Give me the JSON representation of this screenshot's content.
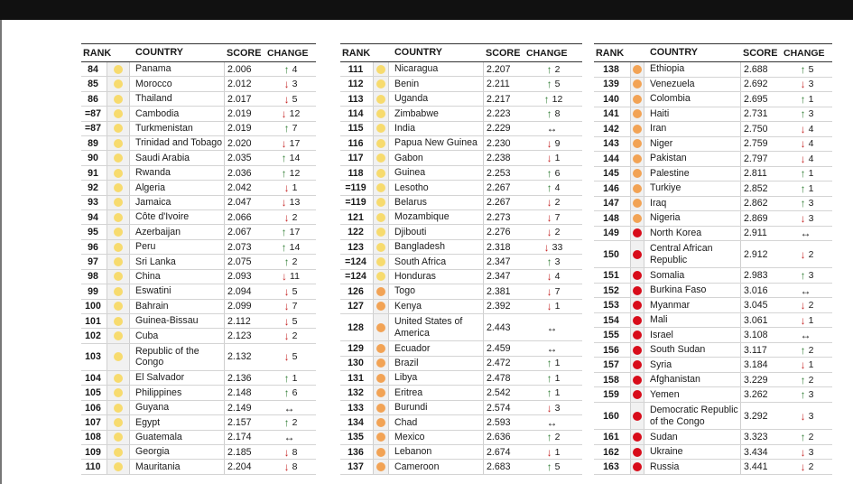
{
  "colors": {
    "very_high": "#d80c1a",
    "high": "#f2a355",
    "medium": "#f7db6e",
    "up_arrow": "#2e7d32",
    "down_arrow": "#c62828",
    "same_arrow": "#1a1a1a"
  },
  "headers": {
    "rank": "RANK",
    "country": "COUNTRY",
    "score": "SCORE",
    "change": "CHANGE"
  },
  "tables": [
    {
      "rows": [
        {
          "rank": "84",
          "country": "Panama",
          "score": "2.006",
          "dir": "up",
          "amount": "4",
          "level": "medium"
        },
        {
          "rank": "85",
          "country": "Morocco",
          "score": "2.012",
          "dir": "down",
          "amount": "3",
          "level": "medium"
        },
        {
          "rank": "86",
          "country": "Thailand",
          "score": "2.017",
          "dir": "down",
          "amount": "5",
          "level": "medium"
        },
        {
          "rank": "=87",
          "country": "Cambodia",
          "score": "2.019",
          "dir": "down",
          "amount": "12",
          "level": "medium"
        },
        {
          "rank": "=87",
          "country": "Turkmenistan",
          "score": "2.019",
          "dir": "up",
          "amount": "7",
          "level": "medium"
        },
        {
          "rank": "89",
          "country": "Trinidad and Tobago",
          "score": "2.020",
          "dir": "down",
          "amount": "17",
          "level": "medium"
        },
        {
          "rank": "90",
          "country": "Saudi Arabia",
          "score": "2.035",
          "dir": "up",
          "amount": "14",
          "level": "medium"
        },
        {
          "rank": "91",
          "country": "Rwanda",
          "score": "2.036",
          "dir": "up",
          "amount": "12",
          "level": "medium"
        },
        {
          "rank": "92",
          "country": "Algeria",
          "score": "2.042",
          "dir": "down",
          "amount": "1",
          "level": "medium"
        },
        {
          "rank": "93",
          "country": "Jamaica",
          "score": "2.047",
          "dir": "down",
          "amount": "13",
          "level": "medium"
        },
        {
          "rank": "94",
          "country": "Côte d'Ivoire",
          "score": "2.066",
          "dir": "down",
          "amount": "2",
          "level": "medium"
        },
        {
          "rank": "95",
          "country": "Azerbaijan",
          "score": "2.067",
          "dir": "up",
          "amount": "17",
          "level": "medium"
        },
        {
          "rank": "96",
          "country": "Peru",
          "score": "2.073",
          "dir": "up",
          "amount": "14",
          "level": "medium"
        },
        {
          "rank": "97",
          "country": "Sri Lanka",
          "score": "2.075",
          "dir": "up",
          "amount": "2",
          "level": "medium"
        },
        {
          "rank": "98",
          "country": "China",
          "score": "2.093",
          "dir": "down",
          "amount": "11",
          "level": "medium"
        },
        {
          "rank": "99",
          "country": "Eswatini",
          "score": "2.094",
          "dir": "down",
          "amount": "5",
          "level": "medium"
        },
        {
          "rank": "100",
          "country": "Bahrain",
          "score": "2.099",
          "dir": "down",
          "amount": "7",
          "level": "medium"
        },
        {
          "rank": "101",
          "country": "Guinea-Bissau",
          "score": "2.112",
          "dir": "down",
          "amount": "5",
          "level": "medium"
        },
        {
          "rank": "102",
          "country": "Cuba",
          "score": "2.123",
          "dir": "down",
          "amount": "2",
          "level": "medium"
        },
        {
          "rank": "103",
          "country": "Republic of the Congo",
          "score": "2.132",
          "dir": "down",
          "amount": "5",
          "level": "medium",
          "tall": true
        },
        {
          "rank": "104",
          "country": "El Salvador",
          "score": "2.136",
          "dir": "up",
          "amount": "1",
          "level": "medium"
        },
        {
          "rank": "105",
          "country": "Philippines",
          "score": "2.148",
          "dir": "up",
          "amount": "6",
          "level": "medium"
        },
        {
          "rank": "106",
          "country": "Guyana",
          "score": "2.149",
          "dir": "same",
          "amount": "",
          "level": "medium"
        },
        {
          "rank": "107",
          "country": "Egypt",
          "score": "2.157",
          "dir": "up",
          "amount": "2",
          "level": "medium"
        },
        {
          "rank": "108",
          "country": "Guatemala",
          "score": "2.174",
          "dir": "same",
          "amount": "",
          "level": "medium"
        },
        {
          "rank": "109",
          "country": "Georgia",
          "score": "2.185",
          "dir": "down",
          "amount": "8",
          "level": "medium"
        },
        {
          "rank": "110",
          "country": "Mauritania",
          "score": "2.204",
          "dir": "down",
          "amount": "8",
          "level": "medium"
        }
      ]
    },
    {
      "rows": [
        {
          "rank": "111",
          "country": "Nicaragua",
          "score": "2.207",
          "dir": "up",
          "amount": "2",
          "level": "medium"
        },
        {
          "rank": "112",
          "country": "Benin",
          "score": "2.211",
          "dir": "up",
          "amount": "5",
          "level": "medium"
        },
        {
          "rank": "113",
          "country": "Uganda",
          "score": "2.217",
          "dir": "up",
          "amount": "12",
          "level": "medium"
        },
        {
          "rank": "114",
          "country": "Zimbabwe",
          "score": "2.223",
          "dir": "up",
          "amount": "8",
          "level": "medium"
        },
        {
          "rank": "115",
          "country": "India",
          "score": "2.229",
          "dir": "same",
          "amount": "",
          "level": "medium"
        },
        {
          "rank": "116",
          "country": "Papua New Guinea",
          "score": "2.230",
          "dir": "down",
          "amount": "9",
          "level": "medium"
        },
        {
          "rank": "117",
          "country": "Gabon",
          "score": "2.238",
          "dir": "down",
          "amount": "1",
          "level": "medium"
        },
        {
          "rank": "118",
          "country": "Guinea",
          "score": "2.253",
          "dir": "up",
          "amount": "6",
          "level": "medium"
        },
        {
          "rank": "=119",
          "country": "Lesotho",
          "score": "2.267",
          "dir": "up",
          "amount": "4",
          "level": "medium"
        },
        {
          "rank": "=119",
          "country": "Belarus",
          "score": "2.267",
          "dir": "down",
          "amount": "2",
          "level": "medium"
        },
        {
          "rank": "121",
          "country": "Mozambique",
          "score": "2.273",
          "dir": "down",
          "amount": "7",
          "level": "medium"
        },
        {
          "rank": "122",
          "country": "Djibouti",
          "score": "2.276",
          "dir": "down",
          "amount": "2",
          "level": "medium"
        },
        {
          "rank": "123",
          "country": "Bangladesh",
          "score": "2.318",
          "dir": "down",
          "amount": "33",
          "level": "medium"
        },
        {
          "rank": "=124",
          "country": "South Africa",
          "score": "2.347",
          "dir": "up",
          "amount": "3",
          "level": "medium"
        },
        {
          "rank": "=124",
          "country": "Honduras",
          "score": "2.347",
          "dir": "down",
          "amount": "4",
          "level": "medium"
        },
        {
          "rank": "126",
          "country": "Togo",
          "score": "2.381",
          "dir": "down",
          "amount": "7",
          "level": "high"
        },
        {
          "rank": "127",
          "country": "Kenya",
          "score": "2.392",
          "dir": "down",
          "amount": "1",
          "level": "high"
        },
        {
          "rank": "128",
          "country": "United States of America",
          "score": "2.443",
          "dir": "same",
          "amount": "",
          "level": "high",
          "tall": true
        },
        {
          "rank": "129",
          "country": "Ecuador",
          "score": "2.459",
          "dir": "same",
          "amount": "",
          "level": "high"
        },
        {
          "rank": "130",
          "country": "Brazil",
          "score": "2.472",
          "dir": "up",
          "amount": "1",
          "level": "high"
        },
        {
          "rank": "131",
          "country": "Libya",
          "score": "2.478",
          "dir": "up",
          "amount": "1",
          "level": "high"
        },
        {
          "rank": "132",
          "country": "Eritrea",
          "score": "2.542",
          "dir": "up",
          "amount": "1",
          "level": "high"
        },
        {
          "rank": "133",
          "country": "Burundi",
          "score": "2.574",
          "dir": "down",
          "amount": "3",
          "level": "high"
        },
        {
          "rank": "134",
          "country": "Chad",
          "score": "2.593",
          "dir": "same",
          "amount": "",
          "level": "high"
        },
        {
          "rank": "135",
          "country": "Mexico",
          "score": "2.636",
          "dir": "up",
          "amount": "2",
          "level": "high"
        },
        {
          "rank": "136",
          "country": "Lebanon",
          "score": "2.674",
          "dir": "down",
          "amount": "1",
          "level": "high"
        },
        {
          "rank": "137",
          "country": "Cameroon",
          "score": "2.683",
          "dir": "up",
          "amount": "5",
          "level": "high"
        }
      ]
    },
    {
      "rows": [
        {
          "rank": "138",
          "country": "Ethiopia",
          "score": "2.688",
          "dir": "up",
          "amount": "5",
          "level": "high"
        },
        {
          "rank": "139",
          "country": "Venezuela",
          "score": "2.692",
          "dir": "down",
          "amount": "3",
          "level": "high"
        },
        {
          "rank": "140",
          "country": "Colombia",
          "score": "2.695",
          "dir": "up",
          "amount": "1",
          "level": "high"
        },
        {
          "rank": "141",
          "country": "Haiti",
          "score": "2.731",
          "dir": "up",
          "amount": "3",
          "level": "high"
        },
        {
          "rank": "142",
          "country": "Iran",
          "score": "2.750",
          "dir": "down",
          "amount": "4",
          "level": "high"
        },
        {
          "rank": "143",
          "country": "Niger",
          "score": "2.759",
          "dir": "down",
          "amount": "4",
          "level": "high"
        },
        {
          "rank": "144",
          "country": "Pakistan",
          "score": "2.797",
          "dir": "down",
          "amount": "4",
          "level": "high"
        },
        {
          "rank": "145",
          "country": "Palestine",
          "score": "2.811",
          "dir": "up",
          "amount": "1",
          "level": "high"
        },
        {
          "rank": "146",
          "country": "Turkiye",
          "score": "2.852",
          "dir": "up",
          "amount": "1",
          "level": "high"
        },
        {
          "rank": "147",
          "country": "Iraq",
          "score": "2.862",
          "dir": "up",
          "amount": "3",
          "level": "high"
        },
        {
          "rank": "148",
          "country": "Nigeria",
          "score": "2.869",
          "dir": "down",
          "amount": "3",
          "level": "high"
        },
        {
          "rank": "149",
          "country": "North Korea",
          "score": "2.911",
          "dir": "same",
          "amount": "",
          "level": "very_high"
        },
        {
          "rank": "150",
          "country": "Central African Republic",
          "score": "2.912",
          "dir": "down",
          "amount": "2",
          "level": "very_high",
          "tall": true
        },
        {
          "rank": "151",
          "country": "Somalia",
          "score": "2.983",
          "dir": "up",
          "amount": "3",
          "level": "very_high"
        },
        {
          "rank": "152",
          "country": "Burkina Faso",
          "score": "3.016",
          "dir": "same",
          "amount": "",
          "level": "very_high"
        },
        {
          "rank": "153",
          "country": "Myanmar",
          "score": "3.045",
          "dir": "down",
          "amount": "2",
          "level": "very_high"
        },
        {
          "rank": "154",
          "country": "Mali",
          "score": "3.061",
          "dir": "down",
          "amount": "1",
          "level": "very_high"
        },
        {
          "rank": "155",
          "country": "Israel",
          "score": "3.108",
          "dir": "same",
          "amount": "",
          "level": "very_high"
        },
        {
          "rank": "156",
          "country": "South Sudan",
          "score": "3.117",
          "dir": "up",
          "amount": "2",
          "level": "very_high"
        },
        {
          "rank": "157",
          "country": "Syria",
          "score": "3.184",
          "dir": "down",
          "amount": "1",
          "level": "very_high"
        },
        {
          "rank": "158",
          "country": "Afghanistan",
          "score": "3.229",
          "dir": "up",
          "amount": "2",
          "level": "very_high"
        },
        {
          "rank": "159",
          "country": "Yemen",
          "score": "3.262",
          "dir": "up",
          "amount": "3",
          "level": "very_high"
        },
        {
          "rank": "160",
          "country": "Democratic Republic of the Congo",
          "score": "3.292",
          "dir": "down",
          "amount": "3",
          "level": "very_high",
          "tall": true
        },
        {
          "rank": "161",
          "country": "Sudan",
          "score": "3.323",
          "dir": "up",
          "amount": "2",
          "level": "very_high"
        },
        {
          "rank": "162",
          "country": "Ukraine",
          "score": "3.434",
          "dir": "down",
          "amount": "3",
          "level": "very_high"
        },
        {
          "rank": "163",
          "country": "Russia",
          "score": "3.441",
          "dir": "down",
          "amount": "2",
          "level": "very_high"
        }
      ]
    }
  ]
}
